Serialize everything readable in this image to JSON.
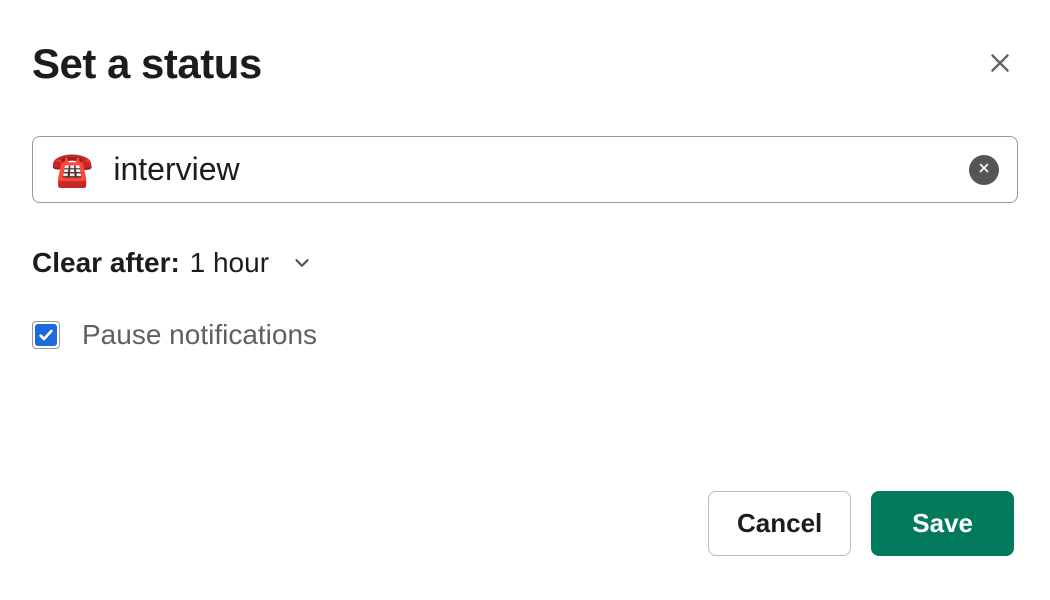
{
  "dialog": {
    "title": "Set a status"
  },
  "status": {
    "emoji": "☎️",
    "text": "interview"
  },
  "clear_after": {
    "label": "Clear after",
    "value": "1 hour"
  },
  "pause_notifications": {
    "label": "Pause notifications",
    "checked": true
  },
  "buttons": {
    "cancel": "Cancel",
    "save": "Save"
  }
}
